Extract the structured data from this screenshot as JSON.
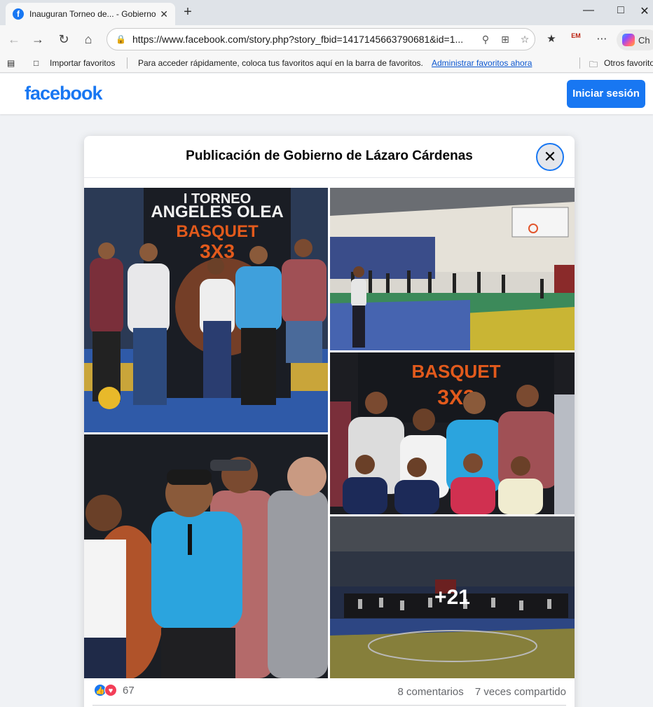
{
  "browser": {
    "tab_title": "Inauguran Torneo de... - Gobierno",
    "tab_close": "✕",
    "new_tab": "+",
    "url": "https://www.facebook.com/story.php?story_fbid=1417145663790681&id=1...",
    "copilot_label": "Ch",
    "ext_label": "EM",
    "favorites_bar": {
      "import": "Importar favoritos",
      "hint": "Para acceder rápidamente, coloca tus favoritos aquí en la barra de favoritos.",
      "manage": "Administrar favoritos ahora",
      "other": "Otros favorito"
    }
  },
  "facebook": {
    "logo": "facebook",
    "login_button": "Iniciar sesión"
  },
  "post": {
    "title": "Publicación de Gobierno de Lázaro Cárdenas",
    "close": "✕",
    "more_photos": "+21",
    "reaction_count": "67",
    "comments": "8 comentarios",
    "shares": "7 veces compartido"
  }
}
